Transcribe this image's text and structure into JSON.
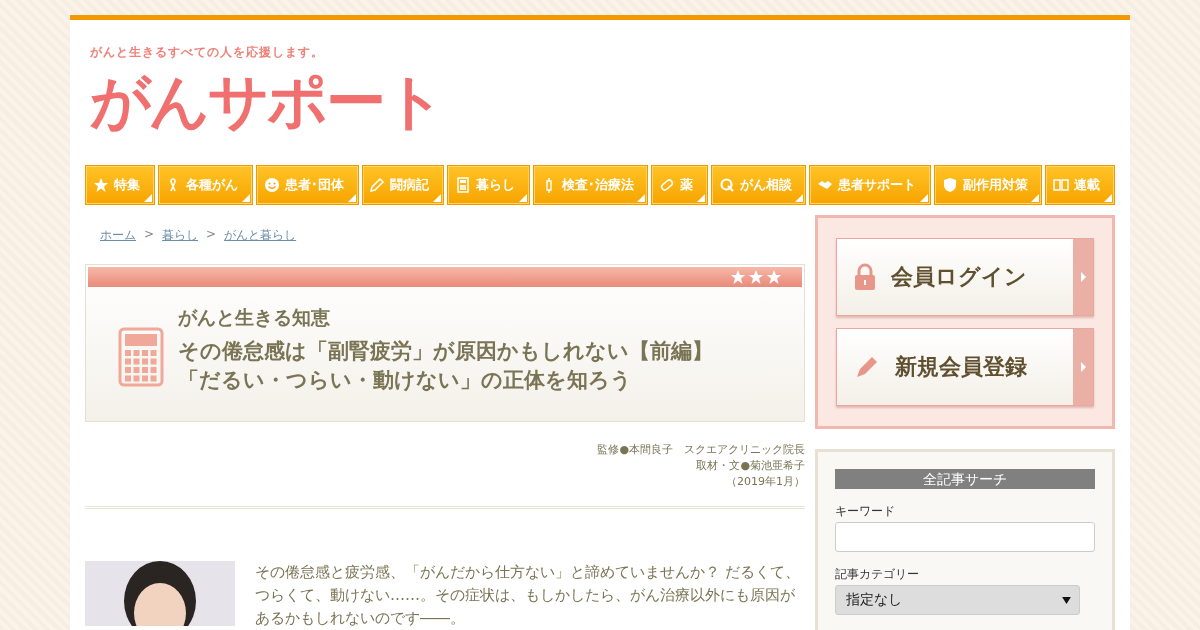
{
  "header": {
    "tagline": "がんと生きるすべての人を応援します。",
    "logo": "がんサポート"
  },
  "nav": [
    {
      "label": "特集"
    },
    {
      "label": "各種がん"
    },
    {
      "label": "患者･団体"
    },
    {
      "label": "闘病記"
    },
    {
      "label": "暮らし"
    },
    {
      "label": "検査･治療法"
    },
    {
      "label": "薬"
    },
    {
      "label": "がん相談"
    },
    {
      "label": "患者サポート"
    },
    {
      "label": "副作用対策"
    },
    {
      "label": "連載"
    }
  ],
  "breadcrumb": [
    "ホーム",
    "暮らし",
    "がんと暮らし"
  ],
  "breadcrumb_separator": ">",
  "article": {
    "stars": 3,
    "category": "がんと生きる知恵",
    "title_lines": [
      "その倦怠感は「副腎疲労」が原因かもしれない【前編】",
      "「だるい・つらい・動けない」の正体を知ろう"
    ],
    "credits": [
      "監修●本間良子　スクエアクリニック院長",
      "取材・文●菊池亜希子",
      "（2019年1月）"
    ],
    "photo": {
      "kind": "picture"
    },
    "lead": "その倦怠感と疲労感、「がんだから仕方ない」と諦めていませんか？ だるくて、つらくて、動けない……。その症状は、もしかしたら、がん治療以外にも原因があるかもしれないのです――。"
  },
  "member": {
    "buttons": [
      {
        "label": "会員ログイン",
        "kind": "login"
      },
      {
        "label": "新規会員登録",
        "kind": "register"
      }
    ]
  },
  "search": {
    "title": "全記事サーチ",
    "keyword_label": "キーワード",
    "category_label": "記事カテゴリー",
    "category_value": "指定なし"
  }
}
